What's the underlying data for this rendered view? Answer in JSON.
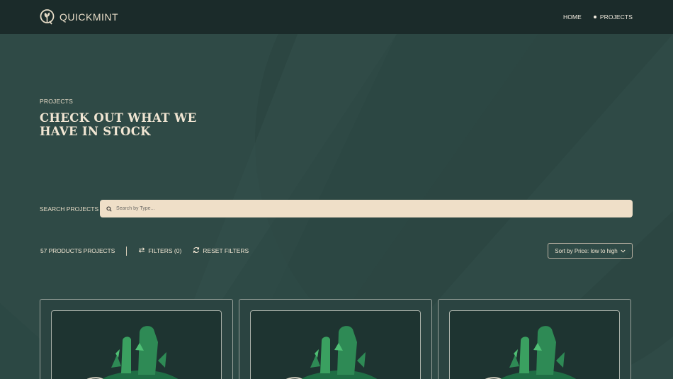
{
  "brand": {
    "name": "QUICKMINT",
    "logo_icon": "sprout-logo-icon"
  },
  "nav": {
    "items": [
      {
        "label": "HOME"
      },
      {
        "label": "PROJECTS",
        "active": true
      }
    ]
  },
  "hero": {
    "eyebrow": "PROJECTS",
    "headline": "CHECK OUT WHAT WE HAVE IN STOCK"
  },
  "search": {
    "label": "SEARCH PROJECTS",
    "placeholder": "Search by Type...",
    "icon": "search-icon"
  },
  "toolbar": {
    "count_text": "57 PRODUCTS PROJECTS",
    "filters_label": "FILTERS (0)",
    "filters_icon": "swap-arrows-icon",
    "reset_label": "RESET FILTERS",
    "reset_icon": "refresh-icon"
  },
  "sort": {
    "selected": "Sort by Price: low to high",
    "icon": "chevron-down-icon"
  },
  "products": [
    {
      "image": "tree-stump-art"
    },
    {
      "image": "tree-stump-art"
    },
    {
      "image": "tree-stump-art"
    }
  ],
  "colors": {
    "background": "#2f4a46",
    "topbar": "#1b2b2a",
    "accent_cream": "#efdfc8",
    "card_bg": "#1e3431",
    "art_green": "#2e8a55"
  }
}
